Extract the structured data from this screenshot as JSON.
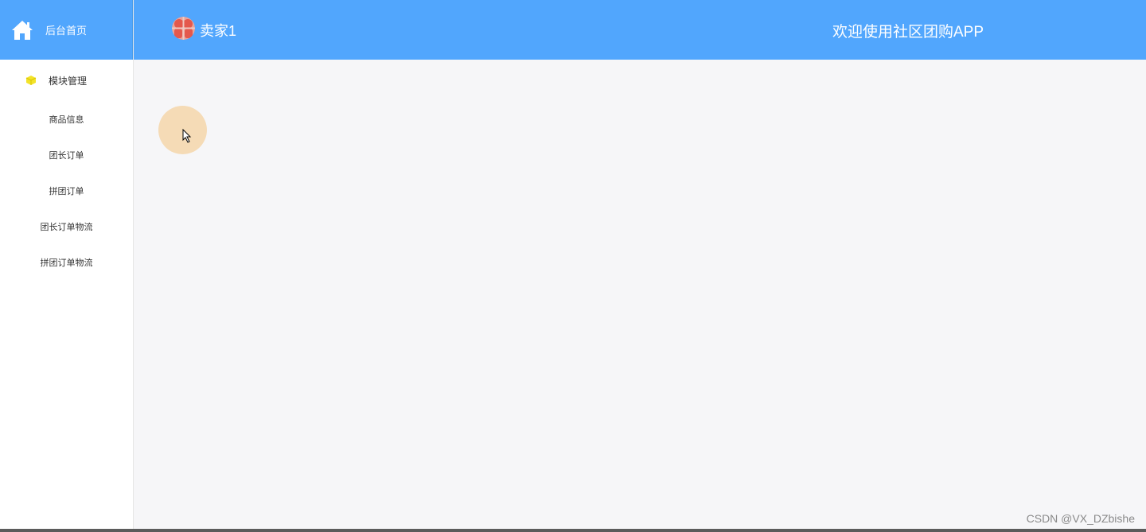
{
  "sidebar": {
    "home_label": "后台首页",
    "home_icon": "home-icon",
    "group_label": "模块管理",
    "group_icon": "cube-icon",
    "items": [
      {
        "label": "商品信息"
      },
      {
        "label": "团长订单"
      },
      {
        "label": "拼团订单"
      },
      {
        "label": "团长订单物流"
      },
      {
        "label": "拼团订单物流"
      }
    ]
  },
  "header": {
    "username": "卖家1",
    "avatar_icon": "avatar",
    "welcome": "欢迎使用社区团购APP"
  },
  "watermark": "CSDN @VX_DZbishe",
  "colors": {
    "header_bg": "#51a6fd",
    "content_bg": "#f6f6f8",
    "cursor_highlight": "#f5dbb6",
    "cube": "#f3e32a"
  }
}
